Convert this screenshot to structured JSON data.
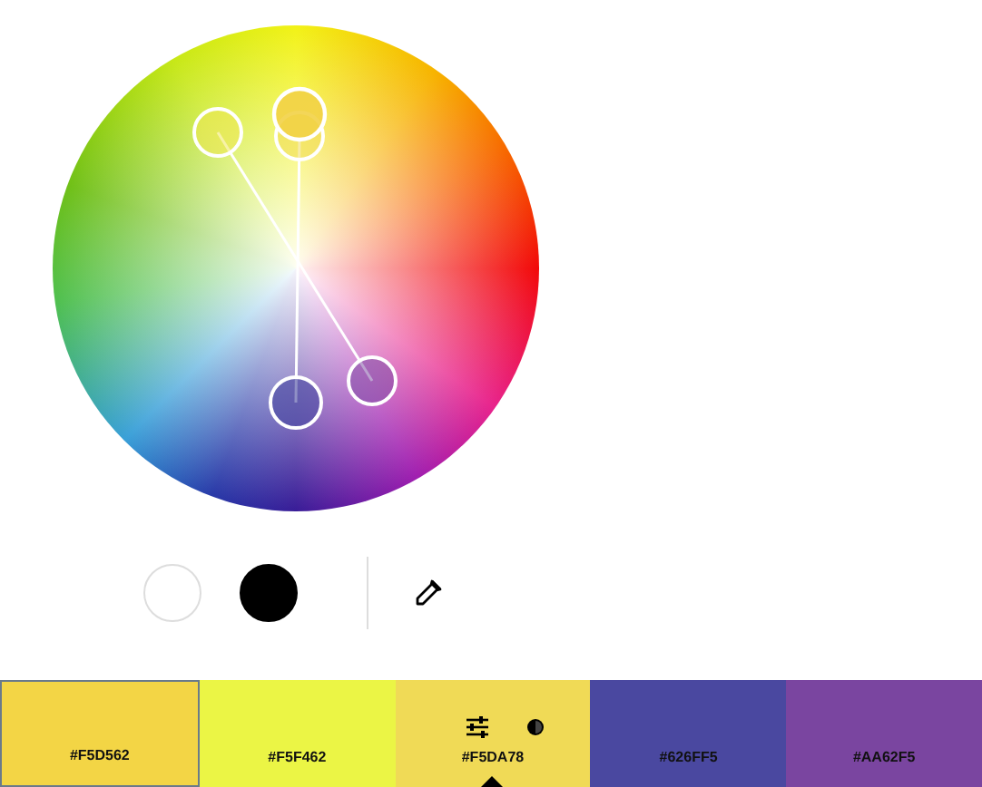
{
  "tools": [
    {
      "kind": "white"
    },
    {
      "kind": "black"
    },
    {
      "kind": "eyedropper"
    }
  ],
  "swatches": [
    {
      "label": "#F5D562",
      "color": "#f3d545",
      "selected": false,
      "outlined": true
    },
    {
      "label": "#F5F462",
      "color": "#ebf545",
      "selected": false,
      "outlined": false
    },
    {
      "label": "#F5DA78",
      "color": "#f0da56",
      "selected": true,
      "outlined": false
    },
    {
      "label": "#626FF5",
      "color": "#4a48a0",
      "selected": false,
      "outlined": false
    },
    {
      "label": "#AA62F5",
      "color": "#7a45a0",
      "selected": false,
      "outlined": false
    }
  ]
}
